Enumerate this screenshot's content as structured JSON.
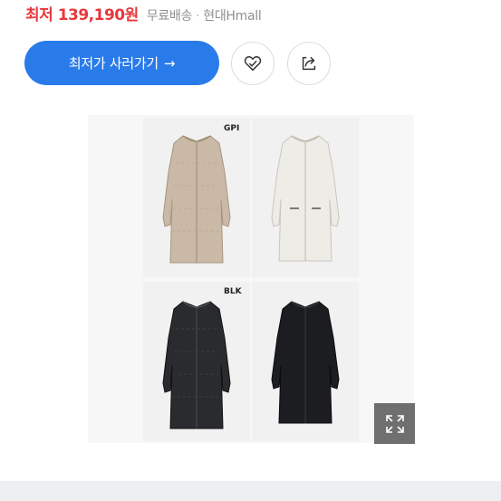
{
  "price": {
    "main": "최저 139,190원",
    "shipping": "무료배송",
    "separator": "·",
    "store": "현대Hmall"
  },
  "actions": {
    "buy_label": "최저가 사러가기",
    "buy_arrow": "→",
    "accent_color": "#2a7bea",
    "price_color": "#e8373c"
  },
  "gallery": {
    "labels": [
      "GPI",
      "BLK"
    ],
    "variants": [
      {
        "color_name": "beige",
        "color": "#c9b9a6"
      },
      {
        "color_name": "ivory",
        "color": "#eeece6"
      },
      {
        "color_name": "black-quilted",
        "color": "#2a2b2e"
      },
      {
        "color_name": "black",
        "color": "#1c1d20"
      }
    ]
  }
}
